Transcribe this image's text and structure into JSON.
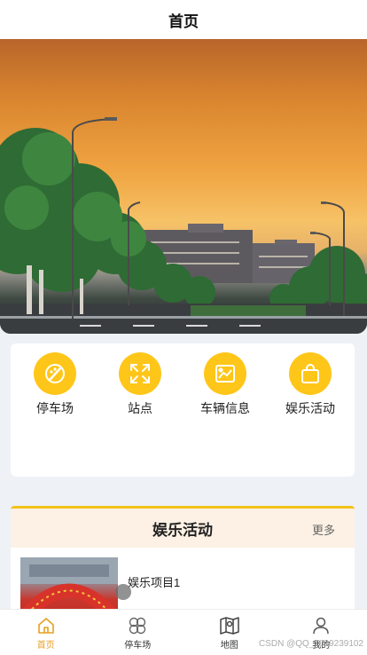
{
  "header": {
    "title": "首页"
  },
  "menu": {
    "items": [
      {
        "label": "停车场",
        "icon": "parking-brush-icon"
      },
      {
        "label": "站点",
        "icon": "expand-arrows-icon"
      },
      {
        "label": "车辆信息",
        "icon": "image-chart-icon"
      },
      {
        "label": "娱乐活动",
        "icon": "shopping-bag-icon"
      }
    ],
    "icon_color": "#ffc61a"
  },
  "activity": {
    "title": "娱乐活动",
    "more": "更多",
    "items": [
      {
        "title": "娱乐项目1"
      }
    ]
  },
  "tabbar": {
    "items": [
      {
        "label": "首页",
        "icon": "home-icon",
        "active": true
      },
      {
        "label": "停车场",
        "icon": "grid-petals-icon",
        "active": false
      },
      {
        "label": "地图",
        "icon": "map-icon",
        "active": false
      },
      {
        "label": "我的",
        "icon": "user-icon",
        "active": false
      }
    ],
    "active_color": "#e8a020"
  },
  "watermark": "CSDN @QQ_1039239102"
}
